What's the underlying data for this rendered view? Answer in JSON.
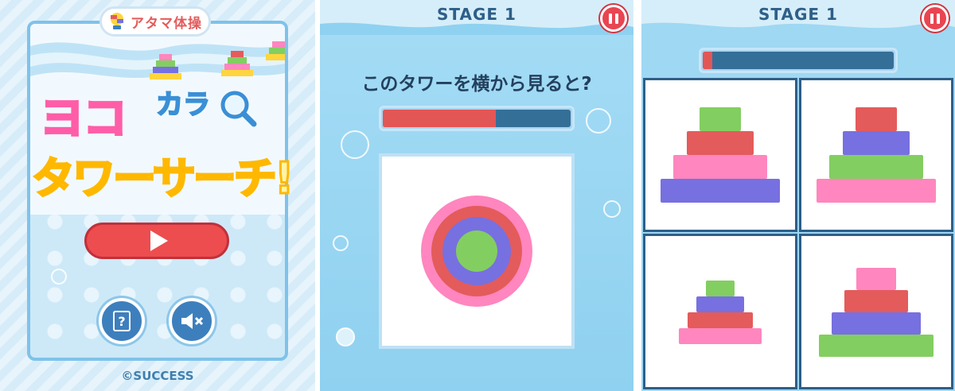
{
  "colors": {
    "pink": "#ff86be",
    "red": "#e45b5b",
    "purple": "#7770e0",
    "green": "#83ce61",
    "timer_fill": "#e25656",
    "timer_track": "#346f98"
  },
  "title_screen": {
    "brand": "アタマ体操",
    "game_title_line1": "ヨコ",
    "game_title_line1_small": "カラ",
    "game_title_line2": "タワーサーチ!",
    "play_icon": "play-icon",
    "help_icon": "help-book-icon",
    "help_glyph": "?",
    "mute_icon": "sound-muted-icon",
    "copyright": "©SUCCESS"
  },
  "question_screen": {
    "stage": "STAGE 1",
    "question": "このタワーを横から見ると?",
    "timer_remaining_fraction": 0.6,
    "rings_outer_to_inner": [
      "pink",
      "red",
      "purple",
      "green"
    ],
    "pause_icon": "pause-icon"
  },
  "answer_screen": {
    "stage": "STAGE 1",
    "timer_remaining_fraction": 0.05,
    "pause_icon": "pause-icon",
    "choices": [
      {
        "tiers_top_to_bottom": [
          "green",
          "red",
          "pink",
          "purple"
        ]
      },
      {
        "tiers_top_to_bottom": [
          "red",
          "purple",
          "green",
          "pink"
        ]
      },
      {
        "tiers_top_to_bottom": [
          "green",
          "purple",
          "red",
          "pink"
        ]
      },
      {
        "tiers_top_to_bottom": [
          "pink",
          "red",
          "purple",
          "green"
        ]
      }
    ]
  }
}
